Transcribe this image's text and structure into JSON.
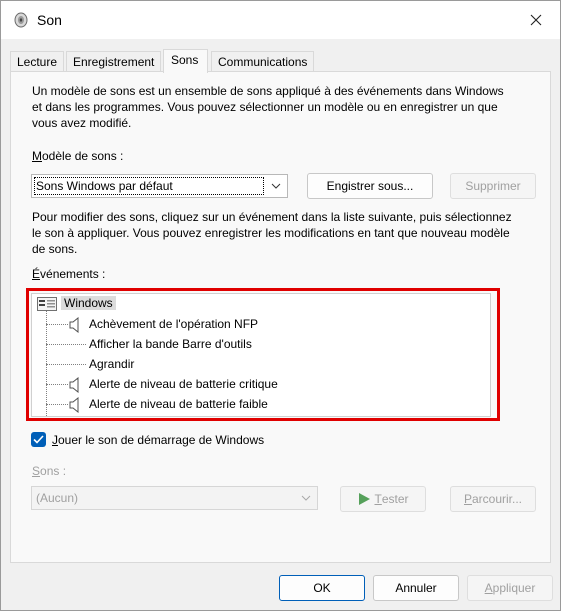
{
  "window": {
    "title": "Son"
  },
  "tabs": [
    {
      "label": "Lecture"
    },
    {
      "label": "Enregistrement"
    },
    {
      "label": "Sons"
    },
    {
      "label": "Communications"
    }
  ],
  "sons": {
    "description": "Un modèle de sons est un ensemble de sons appliqué à des événements dans Windows et dans les programmes. Vous pouvez sélectionner un modèle ou en enregistrer un que vous avez modifié.",
    "scheme_label_accel": "M",
    "scheme_label_rest": "odèle de sons :",
    "scheme_value": "Sons Windows par défaut",
    "save_as_accel": "g",
    "save_as_pre": "En",
    "save_as_post": "istrer sous...",
    "delete_label": "Supprimer",
    "modify_text": "Pour modifier des sons, cliquez sur un événement dans la liste suivante, puis sélectionnez le son à appliquer. Vous pouvez enregistrer les modifications en tant que nouveau modèle de sons.",
    "events_label_accel": "É",
    "events_label_rest": "vénements :",
    "events": {
      "root": "Windows",
      "items": [
        {
          "label": "Achèvement de l'opération NFP",
          "has_sound": true
        },
        {
          "label": "Afficher la bande Barre d'outils",
          "has_sound": false
        },
        {
          "label": "Agrandir",
          "has_sound": false
        },
        {
          "label": "Alerte de niveau de batterie critique",
          "has_sound": true
        },
        {
          "label": "Alerte de niveau de batterie faible",
          "has_sound": true
        }
      ]
    },
    "startup_accel": "J",
    "startup_rest": "ouer le son de démarrage de Windows",
    "startup_checked": true,
    "sounds_label_accel": "S",
    "sounds_label_rest": "ons :",
    "sounds_value": "(Aucun)",
    "test_accel": "T",
    "test_rest": "ester",
    "browse_accel": "P",
    "browse_rest": "arcourir..."
  },
  "footer": {
    "ok": "OK",
    "cancel": "Annuler",
    "apply_accel": "A",
    "apply_rest": "ppliquer"
  },
  "colors": {
    "checkbox": "#005fb8",
    "highlight": "#e00000",
    "play_icon": "#55a05a"
  }
}
